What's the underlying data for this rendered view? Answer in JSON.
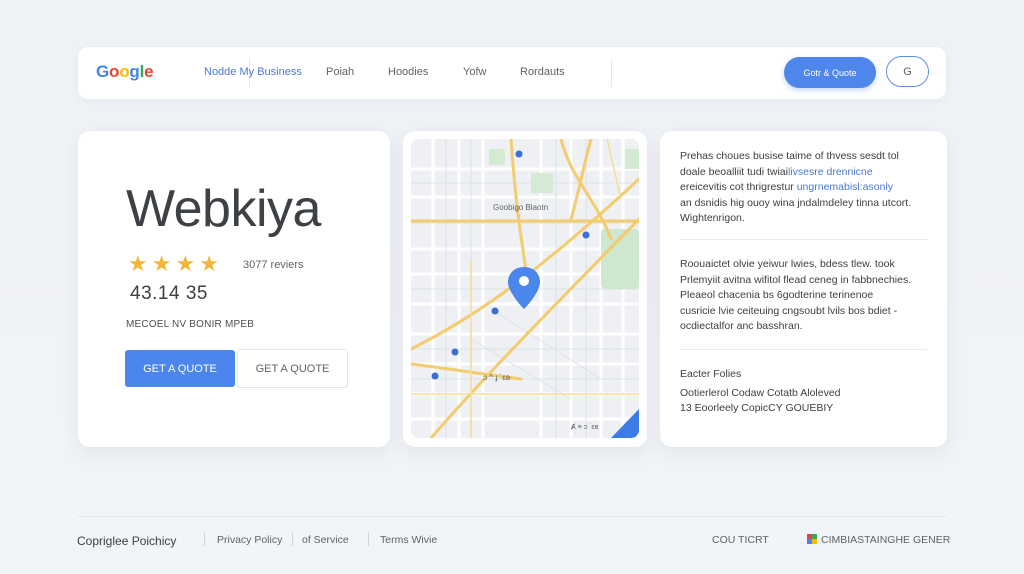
{
  "header": {
    "logo_letters": [
      {
        "ch": "G",
        "color": "#4285F4"
      },
      {
        "ch": "o",
        "color": "#EA4335"
      },
      {
        "ch": "o",
        "color": "#FBBC05"
      },
      {
        "ch": "g",
        "color": "#4285F4"
      },
      {
        "ch": "l",
        "color": "#34A853"
      },
      {
        "ch": "e",
        "color": "#EA4335"
      }
    ],
    "nav": [
      "Nodde My Business",
      "Poiah",
      "Hoodies",
      "Yofw",
      "Rordauts"
    ],
    "quote_label": "Gotr & Quote",
    "g_button": "G"
  },
  "business": {
    "name": "Webkiya",
    "stars": [
      "★",
      "★",
      "★",
      "★"
    ],
    "reviews": "3077  reviers",
    "rating": "43.14   35",
    "caption": "MECOEL NV BONIR MPEB",
    "primary_button": "GET A QUOTE",
    "secondary_button": "GET A QUOTE"
  },
  "map": {
    "label": "Goobigo Blaotn",
    "label2": "ɔ ^ ɟ ˙ɛʙ",
    "label3": "Ⱥ ≡ ɔ ˙ɛʙ"
  },
  "info": {
    "p1_lines": [
      {
        "text": "Prehas choues busise taime of thvess sesdt tol",
        "hl": false
      },
      {
        "pre": "doale beoalliit tudi twiai",
        "hl_text": "livsesre drennicne",
        "hl": true
      },
      {
        "pre": "ereicevitis cot thrigrestur ",
        "hl_text": "ungrnemabisl:asonly",
        "hl": true
      },
      {
        "text": "an dsnidis hig ouoy wina jndalmdeley tinna utcort.",
        "hl": false
      },
      {
        "text": "Wightenrigon.",
        "hl": false
      }
    ],
    "p2_lines": [
      "Roouaictet olvie yeiwur lwies,  bdess tlew. took",
      "Prlemyiit avitna wifitol flead ceneg in fabbnechies.",
      "Pleaeol chacenia bs 6godterine terinenoe",
      "cusricie lvie ceiteuing cngsoubt lvils bos bdiet -",
      "ocdiectalfor anc basshran."
    ],
    "section_label": "Eacter Folies",
    "section_line1": "Ootierlerol Codaw Cotatb Aloleved",
    "section_line2": "13 Eoorleely CopicCY GOUEBIY"
  },
  "footer": {
    "brand": "Copriglee Poichicy",
    "links": [
      "Privacy Policy",
      "of Service",
      "Terms Wivie"
    ],
    "contact": "COU TICRT",
    "right_label": "CIMBIASTAINGHE GENER"
  }
}
